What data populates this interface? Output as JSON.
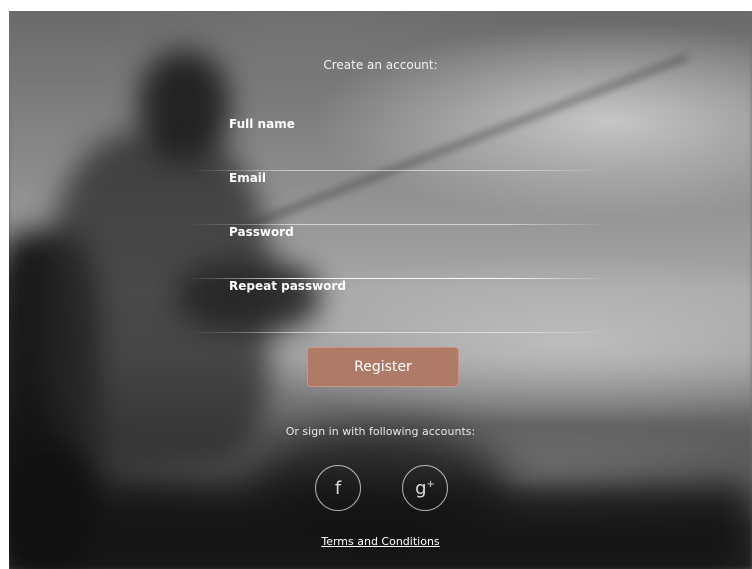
{
  "form": {
    "title": "Create an account:",
    "fields": [
      {
        "label": "Full name"
      },
      {
        "label": "Email"
      },
      {
        "label": "Password"
      },
      {
        "label": "Repeat password"
      }
    ],
    "register_label": "Register"
  },
  "social": {
    "prompt": "Or sign in with following accounts:",
    "facebook_glyph": "f",
    "google_glyph": "g",
    "google_suffix": "+"
  },
  "footer": {
    "terms_label": "Terms and Conditions"
  },
  "colors": {
    "register_button": "#b07a68"
  }
}
